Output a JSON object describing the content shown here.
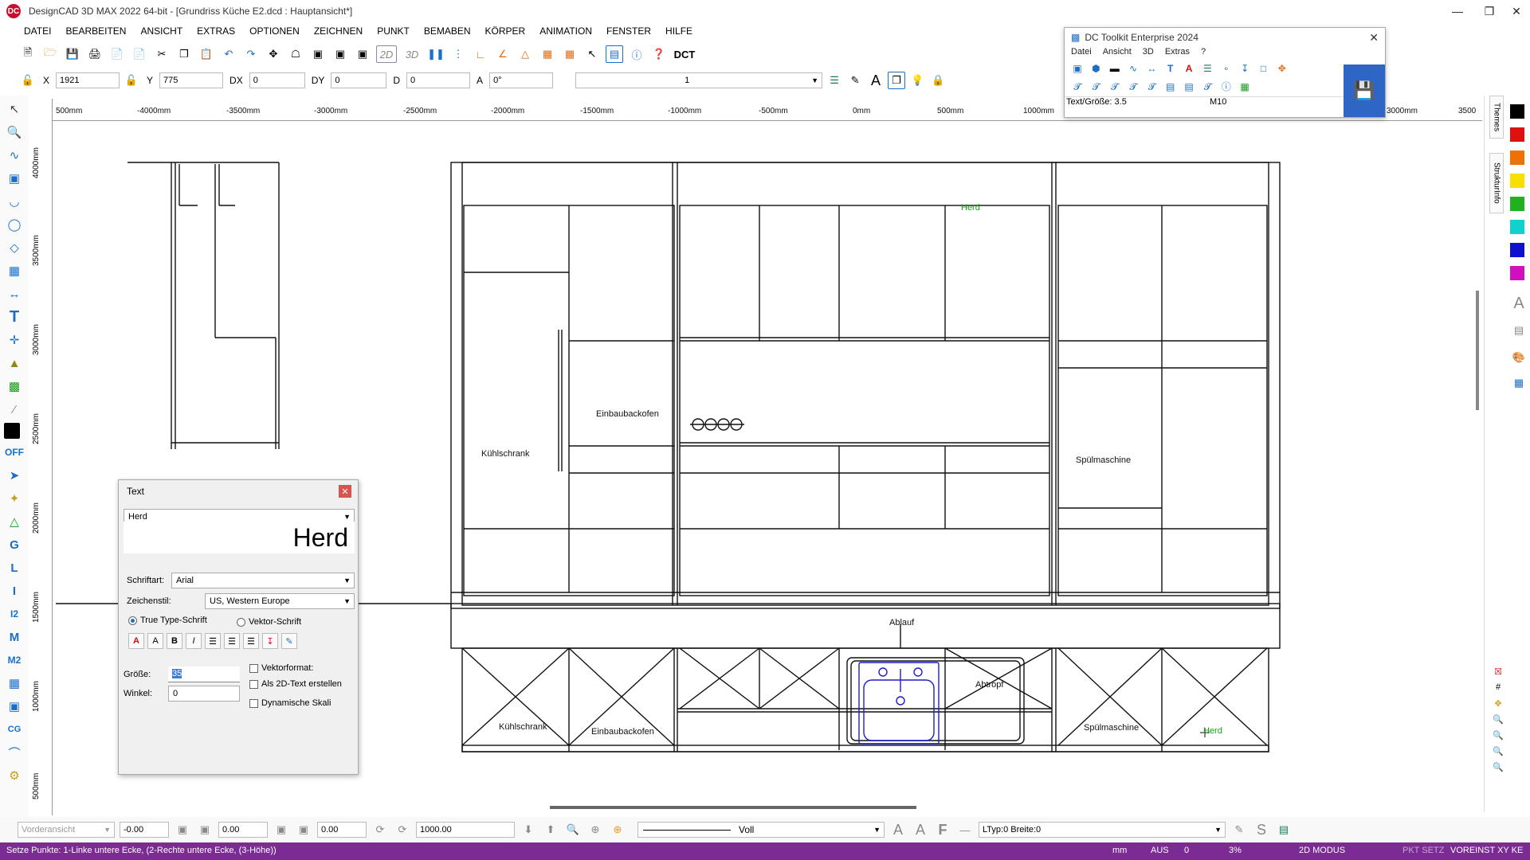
{
  "window": {
    "title": "DesignCAD 3D MAX 2022 64-bit - [Grundriss Küche E2.dcd : Hauptansicht*]",
    "app_badge": "DC"
  },
  "menu": [
    "DATEI",
    "BEARBEITEN",
    "ANSICHT",
    "EXTRAS",
    "OPTIONEN",
    "ZEICHNEN",
    "PUNKT",
    "BEMABEN",
    "KÖRPER",
    "ANIMATION",
    "FENSTER",
    "HILFE"
  ],
  "toolbar": {
    "dct_label": "DCT",
    "btn_2d": "2D",
    "btn_3d": "3D"
  },
  "coords": {
    "x_label": "X",
    "x_value": "1921",
    "y_label": "Y",
    "y_value": "775",
    "dx_label": "DX",
    "dx_value": "0",
    "dy_label": "DY",
    "dy_value": "0",
    "d_label": "D",
    "d_value": "0",
    "a_label": "A",
    "a_value": "0°",
    "layer_value": "1"
  },
  "ruler": {
    "h_ticks": [
      "500mm",
      "-4000mm",
      "-3500mm",
      "-3000mm",
      "-2500mm",
      "-2000mm",
      "-1500mm",
      "-1000mm",
      "-500mm",
      "0mm",
      "500mm",
      "1000mm",
      "3000mm",
      "3500"
    ],
    "v_ticks": [
      "4000mm",
      "3500mm",
      "3000mm",
      "2500mm",
      "2000mm",
      "1500mm",
      "1000mm",
      "500mm"
    ]
  },
  "toolkit": {
    "title": "DC Toolkit Enterprise 2024",
    "menu": [
      "Datei",
      "Ansicht",
      "3D",
      "Extras",
      "?"
    ],
    "status_text": "Text/Größe: 3.5",
    "status_m": "M10"
  },
  "right_tabs": {
    "themes": "Themes",
    "strukturinfo": "StrukturInfo"
  },
  "swatches": [
    "#000000",
    "#e01010",
    "#f07000",
    "#f7e000",
    "#20b020",
    "#10d0d0",
    "#1010d0",
    "#d010c0"
  ],
  "drawing_labels": {
    "herd_top": "Herd",
    "kuehlschrank_upper": "Kühlschrank",
    "einbaubackofen_upper": "Einbaubackofen",
    "spuelmaschine_upper": "Spülmaschine",
    "ablauf": "Ablauf",
    "abtropf": "Abtropf",
    "kuehlschrank_lower": "Kühlschrank",
    "einbaubackofen_lower": "Einbaubackofen",
    "spuelmaschine_lower": "Spülmaschine",
    "herd_lower": "Herd"
  },
  "text_dialog": {
    "title": "Text",
    "text_value": "Herd",
    "preview": "Herd",
    "font_label": "Schriftart:",
    "font_value": "Arial",
    "charset_label": "Zeichenstil:",
    "charset_value": "US, Western Europe",
    "truetype_label": "True Type-Schrift",
    "vector_label": "Vektor-Schrift",
    "size_label": "Größe:",
    "size_value": "35",
    "angle_label": "Winkel:",
    "angle_value": "0",
    "vectorformat_label": "Vektorformat:",
    "as2d_label": "Als 2D-Text erstellen",
    "dynamic_label": "Dynamische Skali"
  },
  "bottombar": {
    "view": "Vorderansicht",
    "v1": "-0.00",
    "v2": "0.00",
    "v3": "0.00",
    "v4": "1000.00",
    "linestyle": "Voll",
    "ltype": "LTyp:0  Breite:0"
  },
  "status": {
    "prompt": "Setze Punkte: 1-Linke untere Ecke, (2-Rechte untere Ecke, (3-Höhe))",
    "unit": "mm",
    "aus": "AUS",
    "zero": "0",
    "percent": "3%",
    "mode": "2D MODUS",
    "pkt": "PKT SETZ",
    "voreinst": "VOREINST XY KE"
  }
}
